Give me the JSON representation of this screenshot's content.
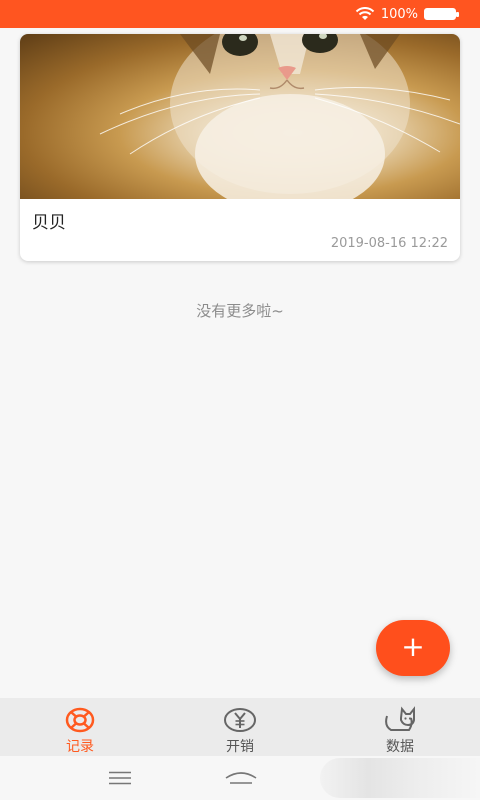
{
  "status_bar": {
    "battery_percent": "100%",
    "color": "#ff5520"
  },
  "pet_card": {
    "name": "贝贝",
    "date": "2019-08-16 12:22",
    "photo_icon": "cat-photo"
  },
  "list_footer": "没有更多啦~",
  "fab": {
    "label": "+",
    "color": "#ff4f1c"
  },
  "tabs": [
    {
      "label": "记录",
      "icon": "lifebuoy-icon",
      "active": true
    },
    {
      "label": "开销",
      "icon": "yen-icon",
      "active": false
    },
    {
      "label": "数据",
      "icon": "cat-icon",
      "active": false
    }
  ],
  "accent_color": "#ff5a1f"
}
